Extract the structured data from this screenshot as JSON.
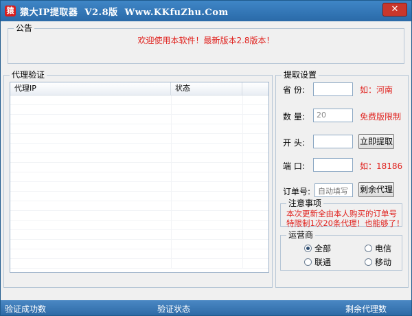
{
  "window": {
    "icon_glyph": "猿",
    "title": "猿大IP提取器  V2.8版  Www.KKfuZhu.Com",
    "close_glyph": "✕"
  },
  "announcement": {
    "label": "公告",
    "text": "欢迎使用本软件！最新版本2.8版本！"
  },
  "proxy_verify": {
    "label": "代理验证",
    "columns": [
      "代理IP",
      "状态",
      ""
    ]
  },
  "extract_settings": {
    "label": "提取设置",
    "province": {
      "label": "省  份:",
      "value": "",
      "hint": "如：河南"
    },
    "quantity": {
      "label": "数  量:",
      "value": "20",
      "hint": "免费版限制"
    },
    "prefix": {
      "label": "开  头:",
      "value": "",
      "button": "立即提取"
    },
    "port": {
      "label": "端  口:",
      "value": "",
      "hint": "如：18186"
    },
    "order": {
      "label": "订单号:",
      "placeholder": "自动填写",
      "button": "剩余代理"
    }
  },
  "caution": {
    "label": "注意事项",
    "line1": "本次更新全由本人购买的订单号",
    "line2": "特限制1次20条代理！也能够了！"
  },
  "carrier": {
    "label": "运营商",
    "options": [
      {
        "label": "全部",
        "selected": true
      },
      {
        "label": "电信",
        "selected": false
      },
      {
        "label": "联通",
        "selected": false
      },
      {
        "label": "移动",
        "selected": false
      }
    ]
  },
  "statusbar": {
    "left": "验证成功数",
    "center": "验证状态",
    "right": "剩余代理数"
  },
  "colors": {
    "title_bar": "#2f74b5",
    "status_bar": "#2e6aa6",
    "accent_red": "#e0201c"
  }
}
